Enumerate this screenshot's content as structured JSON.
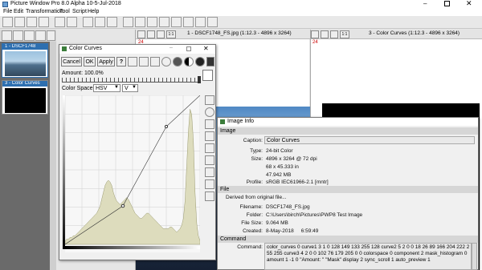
{
  "app": {
    "title": "Picture Window Pro 8.0 Alpha 10-5-Jul-2018"
  },
  "menu": [
    "File",
    "Edit",
    "Transformation",
    "Tool",
    "Script",
    "Help"
  ],
  "thumbnails": [
    {
      "label": "1 - DSCF1748"
    },
    {
      "label": "3 - Color Curves"
    }
  ],
  "image_windows": [
    {
      "title": "1 - DSCF1748_FS.jpg (1:12.3 - 4896 x 3264)",
      "zoom_label": "1:1",
      "ruler": "24"
    },
    {
      "title": "3 - Color Curves (1:12.3 - 4896 x 3264)",
      "zoom_label": "1:1",
      "ruler": "24"
    }
  ],
  "color_curves": {
    "title": "Color Curves",
    "buttons": {
      "cancel": "Cancel",
      "ok": "OK",
      "apply": "Apply",
      "help": "?"
    },
    "amount_label": "Amount: 100.0%",
    "color_space_label": "Color Space:",
    "color_space_value": "HSV",
    "channel_value": "V",
    "histogram": [
      2,
      3,
      3,
      4,
      4,
      5,
      5,
      6,
      7,
      8,
      9,
      10,
      11,
      12,
      13,
      14,
      15,
      16,
      17,
      18,
      20,
      22,
      26,
      30,
      34,
      36,
      37,
      36,
      34,
      30,
      27,
      25,
      24,
      23,
      24,
      25,
      26,
      27,
      26,
      24,
      22,
      20,
      18,
      17,
      16,
      15,
      15,
      16,
      17,
      18,
      18,
      17,
      16,
      15,
      14,
      13,
      12,
      11,
      10,
      9,
      9,
      9,
      9,
      10,
      10,
      9,
      8,
      7,
      8,
      9,
      11,
      15,
      25,
      45,
      65,
      78,
      75,
      60,
      30,
      12,
      5,
      2
    ]
  },
  "image_info": {
    "title": "Image Info",
    "sections": {
      "image": "Image",
      "file": "File",
      "command": "Command"
    },
    "fields": {
      "caption_label": "Caption:",
      "caption": "Color Curves",
      "type_label": "Type:",
      "type": "24-bit Color",
      "size_label": "Size:",
      "size": "4896 x 3264 @ 72 dpi",
      "size2": "68 x 45.333 in",
      "size3": "47.942 MB",
      "profile_label": "Profile:",
      "profile": "sRGB IEC61966-2.1 [mntr]",
      "derived": "Derived from original file...",
      "filename_label": "Filename:",
      "filename": "DSCF1748_FS.jpg",
      "folder_label": "Folder:",
      "folder": "C:\\Users\\birch\\Pictures\\PWP8 Test Image",
      "filesize_label": "File Size:",
      "filesize": "9.064 MB",
      "created_label": "Created:",
      "created": "8-May-2018     6:59:49",
      "command_label": "Command:",
      "command": "color_curves 0 curve1 3 1 0 128 149 133 255 128 curve2 5 2 0 0 18 26 89 166 204 222 255 255 curve3 4 2 0 0 102 76 179 205 0 0 colorspace 0 component 2 mask_histogram 0 amount 1 -1 0 \"Amount: \" \"Mask\" display 2 sync_scroll 1 auto_preview 1"
    }
  }
}
